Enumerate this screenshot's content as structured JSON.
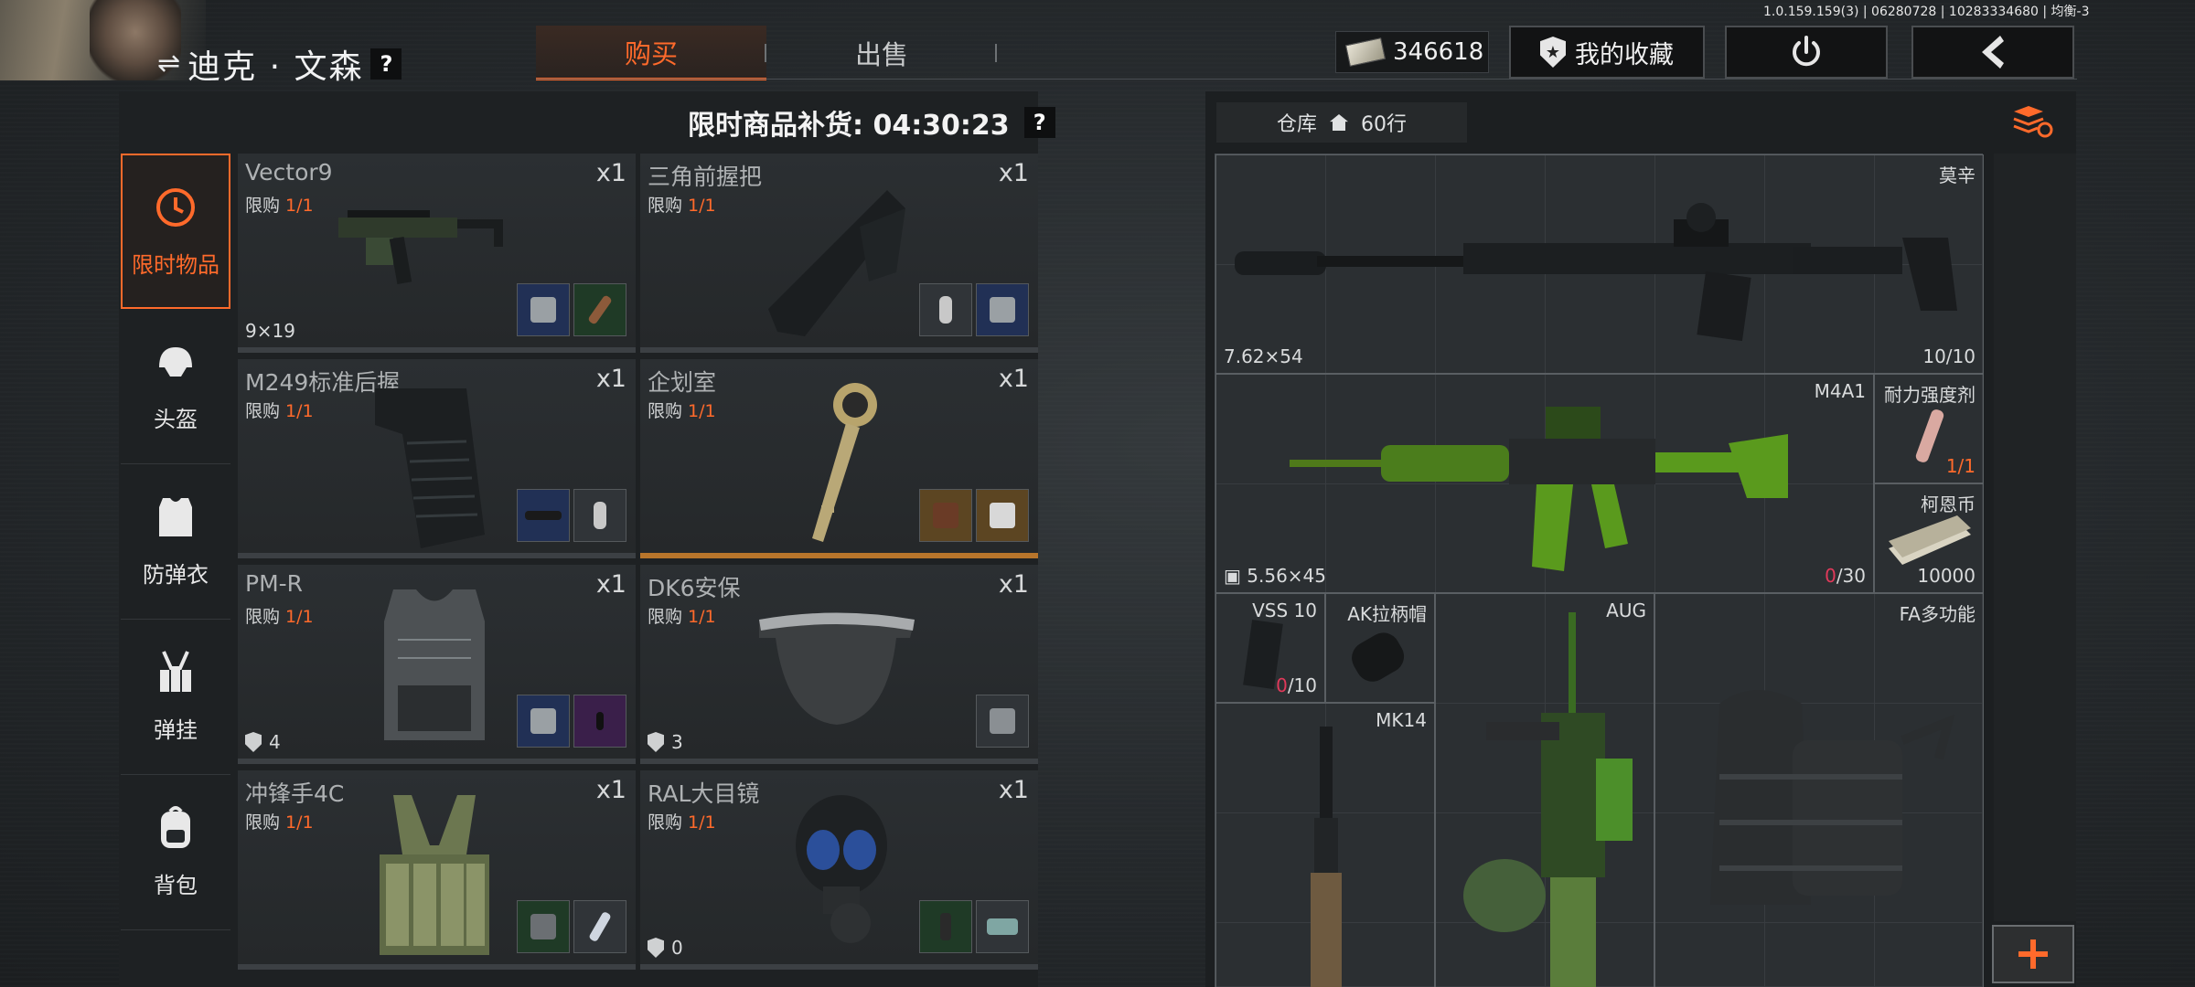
{
  "header": {
    "trader_name": "迪克 · 文森",
    "help": "?",
    "version": "1.0.159.159(3) | 06280728 | 10283334680 | 均衡-3",
    "tabs": [
      {
        "label": "购买"
      },
      {
        "label": "出售"
      }
    ],
    "money": "346618",
    "favorites_label": "我的收藏"
  },
  "shop": {
    "restock_label": "限时商品补货: 04:30:23",
    "help": "?",
    "categories": [
      {
        "label": "限时物品",
        "icon": "clock-icon"
      },
      {
        "label": "头盔",
        "icon": "helmet-icon"
      },
      {
        "label": "防弹衣",
        "icon": "vest-icon"
      },
      {
        "label": "弹挂",
        "icon": "chest-rig-icon"
      },
      {
        "label": "背包",
        "icon": "backpack-icon"
      }
    ],
    "limit_label": "限购",
    "items": [
      {
        "name": "Vector9",
        "qty": "x1",
        "limit": "1/1",
        "sub": "9×19"
      },
      {
        "name": "三角前握把",
        "qty": "x1",
        "limit": "1/1",
        "sub": ""
      },
      {
        "name": "M249标准后握",
        "qty": "x1",
        "limit": "1/1",
        "sub": ""
      },
      {
        "name": "企划室",
        "qty": "x1",
        "limit": "1/1",
        "sub": ""
      },
      {
        "name": "PM-R",
        "qty": "x1",
        "limit": "1/1",
        "armor": "4"
      },
      {
        "name": "DK6安保",
        "qty": "x1",
        "limit": "1/1",
        "armor": "3"
      },
      {
        "name": "冲锋手4C",
        "qty": "x1",
        "limit": "1/1",
        "sub": ""
      },
      {
        "name": "RAL大目镜",
        "qty": "x1",
        "limit": "1/1",
        "armor": "0"
      }
    ]
  },
  "storage": {
    "title": "仓库",
    "rows": "60行",
    "slots": {
      "mosin": {
        "name": "莫辛",
        "caliber": "7.62×54",
        "count": "10/10"
      },
      "m4a1": {
        "name": "M4A1",
        "caliber": "5.56×45",
        "ammo_current": "0",
        "ammo_max": "/30"
      },
      "durability": {
        "name": "耐力强度剂",
        "count": "1/1"
      },
      "coin": {
        "name": "柯恩币",
        "count": "10000"
      },
      "vss": {
        "name": "VSS 10",
        "ammo_current": "0",
        "ammo_max": "/10"
      },
      "ak_cap": {
        "name": "AK拉柄帽"
      },
      "aug": {
        "name": "AUG"
      },
      "fa": {
        "name": "FA多功能"
      },
      "mk14": {
        "name": "MK14"
      }
    }
  },
  "colors": {
    "accent": "#ff6a2b",
    "ammo_empty": "#e0395a"
  }
}
